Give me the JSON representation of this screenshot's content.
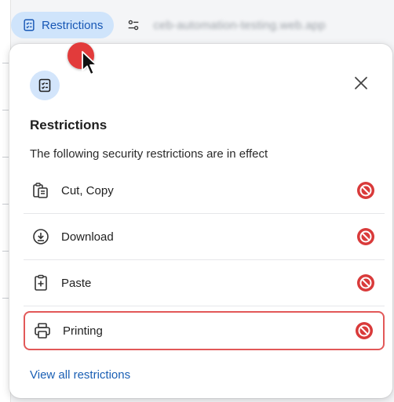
{
  "topbar": {
    "restrictions_label": "Restrictions",
    "url_text": "ceb-automation-testing.web.app"
  },
  "panel": {
    "title": "Restrictions",
    "description": "The following security restrictions are in effect",
    "items": [
      {
        "label": "Cut, Copy",
        "icon": "clipboard-copy-icon",
        "status": "blocked"
      },
      {
        "label": "Download",
        "icon": "download-icon",
        "status": "blocked"
      },
      {
        "label": "Paste",
        "icon": "paste-icon",
        "status": "blocked"
      },
      {
        "label": "Printing",
        "icon": "printer-icon",
        "status": "blocked",
        "highlighted": true
      }
    ],
    "view_all_label": "View all restrictions"
  },
  "colors": {
    "accent": "#1a5fb4",
    "pill_bg": "#cfe4fb",
    "blocked_red": "#d93a3a",
    "highlight_border": "#e25858"
  }
}
